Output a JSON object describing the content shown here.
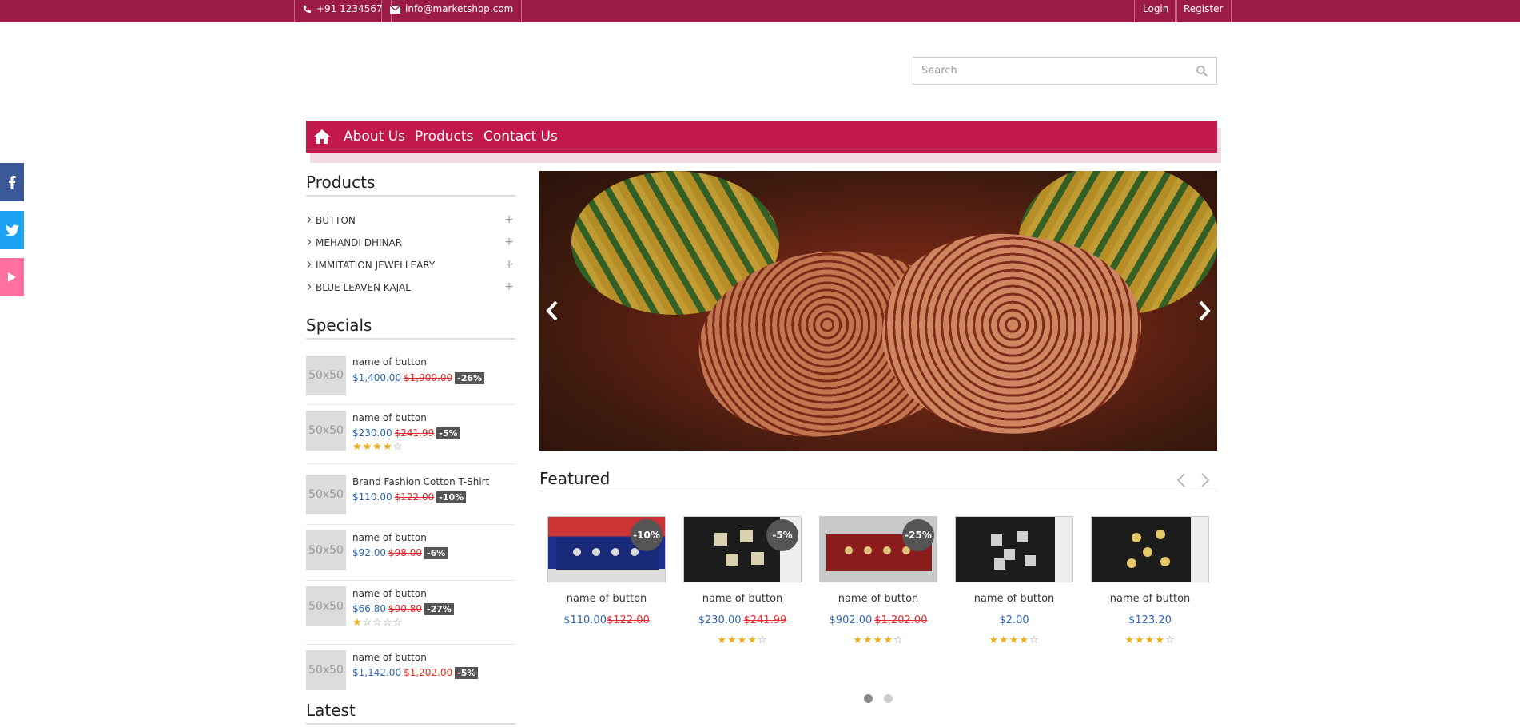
{
  "topbar": {
    "phone": "+91 1234567",
    "email": "info@marketshop.com",
    "login": "Login",
    "register": "Register"
  },
  "search": {
    "placeholder": "Search"
  },
  "nav": {
    "items": [
      "About Us",
      "Products",
      "Contact Us"
    ]
  },
  "social": [
    "facebook-icon",
    "twitter-icon",
    "youtube-icon"
  ],
  "sidebar": {
    "products_title": "Products",
    "categories": [
      "BUTTON",
      "MEHANDI DHINAR",
      "IMMITATION JEWELLEARY",
      "BLUE LEAVEN KAJAL"
    ],
    "specials_title": "Specials",
    "specials": [
      {
        "thumb": "50x50",
        "name": "name of button",
        "price": "$1,400.00",
        "old": "$1,900.00",
        "discount": "-26%",
        "rating": null
      },
      {
        "thumb": "50x50",
        "name": "name of button",
        "price": "$230.00",
        "old": "$241.99",
        "discount": "-5%",
        "rating": 4
      },
      {
        "thumb": "50x50",
        "name": "Brand Fashion Cotton T-Shirt",
        "price": "$110.00",
        "old": "$122.00",
        "discount": "-10%",
        "rating": null
      },
      {
        "thumb": "50x50",
        "name": "name of button",
        "price": "$92.00",
        "old": "$98.00",
        "discount": "-6%",
        "rating": null
      },
      {
        "thumb": "50x50",
        "name": "name of button",
        "price": "$66.80",
        "old": "$90.80",
        "discount": "-27%",
        "rating": 1
      },
      {
        "thumb": "50x50",
        "name": "name of button",
        "price": "$1,142.00",
        "old": "$1,202.00",
        "discount": "-5%",
        "rating": null
      }
    ],
    "latest_title": "Latest"
  },
  "featured": {
    "title": "Featured",
    "products": [
      {
        "name": "name of button",
        "price": "$110.00",
        "old": "$122.00",
        "badge": "-10%",
        "rating": null
      },
      {
        "name": "name of button",
        "price": "$230.00",
        "old": "$241.99",
        "badge": "-5%",
        "rating": 4
      },
      {
        "name": "name of button",
        "price": "$902.00",
        "old": "$1,202.00",
        "badge": "-25%",
        "rating": 4
      },
      {
        "name": "name of button",
        "price": "$2.00",
        "old": "",
        "badge": "",
        "rating": 4
      },
      {
        "name": "name of button",
        "price": "$123.20",
        "old": "",
        "badge": "",
        "rating": 4
      }
    ],
    "pagination_active": 1
  },
  "colors": {
    "brand": "#c2184b",
    "topbar": "#9b1b44",
    "price": "#2f67b3",
    "old_price": "#e62929"
  }
}
